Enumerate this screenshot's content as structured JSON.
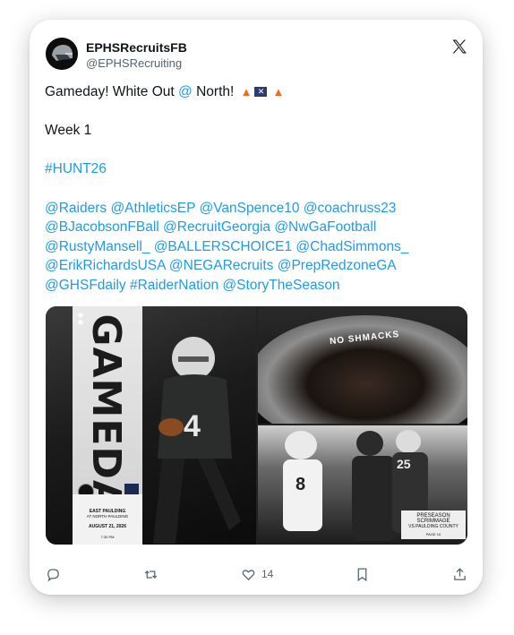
{
  "author": {
    "name": "EPHSRecruitsFB",
    "handle": "@EPHSRecruiting"
  },
  "tweet": {
    "line1_text": "Gameday! White Out ",
    "line1_mention": "@",
    "line1_rest": " North!",
    "line2": "Week 1",
    "hashtag": "#HUNT26",
    "mentions": [
      "@Raiders @AthleticsEP @VanSpence10 @coachruss23",
      "@BJacobsonFBall @RecruitGeorgia @NwGaFootball",
      "@RustyMansell_ @BALLERSCHOICE1 @ChadSimmons_",
      "@ErikRichardsUSA @NEGARecruits @PrepRedzoneGA",
      "@GHSFdaily #RaiderNation @StoryTheSeason"
    ]
  },
  "media": {
    "gameday_word": "GAMEDAY",
    "matchup": "EAST PAULDING",
    "matchup_sub": "AT NORTH PAULDING",
    "date": "AUGUST 21, 2026",
    "time": "7:30 PM",
    "jersey_number": "4",
    "eyeblack_text": "NO SHMACKS",
    "scrimmage_title": "PRESEASON SCRIMMAGE",
    "scrimmage_sub": "VS PAULDING COUNTY",
    "scrimmage_page": "PAGE 10"
  },
  "actions": {
    "likes": "14"
  },
  "colors": {
    "link": "#1d9bf0",
    "text": "#0f1419",
    "muted": "#536471"
  }
}
